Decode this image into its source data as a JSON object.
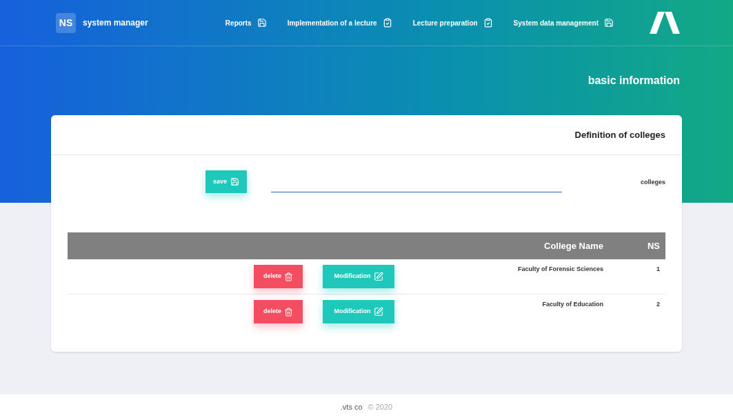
{
  "brand": {
    "badge": "NS",
    "name": "system manager"
  },
  "nav": [
    {
      "label": "Reports",
      "kind": "save"
    },
    {
      "label": "Implementation of a lecture",
      "kind": "clipboard"
    },
    {
      "label": "Lecture preparation",
      "kind": "clipboard"
    },
    {
      "label": "System data management",
      "kind": "save"
    }
  ],
  "page_title": "basic information",
  "card": {
    "title": "Definition of colleges",
    "form": {
      "label": "colleges",
      "save_button": "save"
    },
    "table": {
      "columns": [
        "College Name",
        "NS"
      ],
      "rows": [
        {
          "college_name": "Faculty of Forensic Sciences",
          "ns": "1",
          "delete_button": "delete",
          "modify_button": "Modification"
        },
        {
          "college_name": "Faculty of Education",
          "ns": "2",
          "delete_button": "delete",
          "modify_button": "Modification"
        }
      ]
    }
  },
  "footer": {
    "company": ".vts co",
    "copyright": "© 2020"
  }
}
